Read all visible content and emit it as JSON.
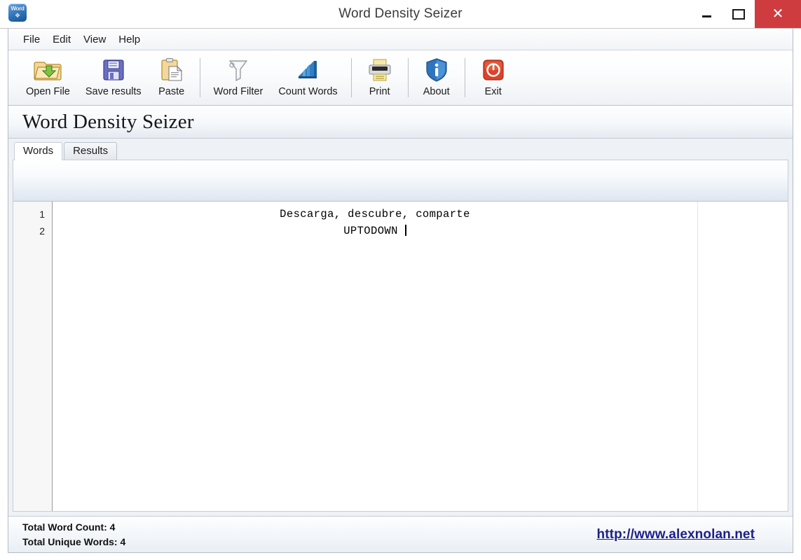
{
  "window": {
    "title": "Word Density Seizer",
    "app_icon": "word-app-icon",
    "icon_caption": "Word",
    "minimize_label": "–",
    "maximize_label": "□",
    "close_label": "✕"
  },
  "menubar": {
    "items": [
      {
        "label": "File"
      },
      {
        "label": "Edit"
      },
      {
        "label": "View"
      },
      {
        "label": "Help"
      }
    ]
  },
  "toolbar": {
    "buttons": [
      {
        "label": "Open File",
        "icon": "open-folder-icon"
      },
      {
        "label": "Save results",
        "icon": "floppy-disk-icon"
      },
      {
        "label": "Paste",
        "icon": "clipboard-paste-icon"
      },
      {
        "label": "Word Filter",
        "icon": "funnel-filter-icon"
      },
      {
        "label": "Count Words",
        "icon": "bar-chart-icon"
      },
      {
        "label": "Print",
        "icon": "printer-icon"
      },
      {
        "label": "About",
        "icon": "info-shield-icon"
      },
      {
        "label": "Exit",
        "icon": "power-exit-icon"
      }
    ]
  },
  "header": {
    "title": "Word Density Seizer"
  },
  "tabs": [
    {
      "label": "Words",
      "active": true
    },
    {
      "label": "Results",
      "active": false
    }
  ],
  "editor": {
    "line_numbers": [
      "1",
      "2"
    ],
    "lines": [
      "Descarga, descubre, comparte",
      "UPTODOWN"
    ]
  },
  "statusbar": {
    "word_count": "Total Word Count: 4",
    "unique_words": "Total Unique Words: 4",
    "link": "http://www.alexnolan.net"
  },
  "colors": {
    "close_button": "#cf3c3f",
    "link": "#1b1f8a",
    "frame_border": "#b4bcc6",
    "toolbar_separator": "#b9c2cc"
  }
}
